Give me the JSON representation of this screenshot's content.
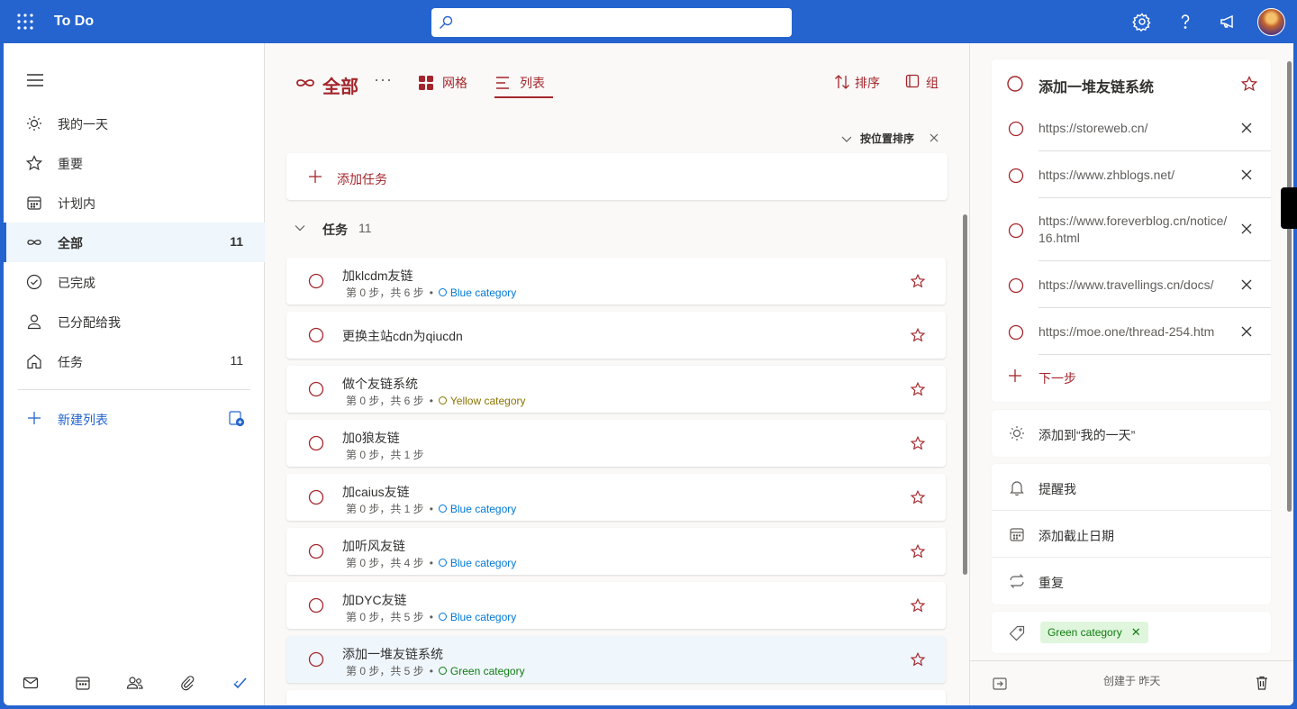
{
  "app": {
    "title": "To Do"
  },
  "search": {
    "value": "",
    "placeholder": ""
  },
  "colors": {
    "brand": "#2564cf",
    "accent": "#a4262c",
    "blue_category": "#0078d4",
    "yellow_category": "#8a7400",
    "green_category": "#107c10"
  },
  "sidebar": {
    "items": [
      {
        "label": "我的一天",
        "count": "",
        "icon": "sun-icon"
      },
      {
        "label": "重要",
        "count": "",
        "icon": "star-icon"
      },
      {
        "label": "计划内",
        "count": "",
        "icon": "calendar-icon"
      },
      {
        "label": "全部",
        "count": "11",
        "icon": "infinity-icon"
      },
      {
        "label": "已完成",
        "count": "",
        "icon": "check-circle-icon"
      },
      {
        "label": "已分配给我",
        "count": "",
        "icon": "person-icon"
      },
      {
        "label": "任务",
        "count": "11",
        "icon": "home-icon"
      }
    ],
    "new_list_label": "新建列表"
  },
  "list": {
    "title": "全部",
    "more": "···",
    "view_grid": "网格",
    "view_list": "列表",
    "sort_label": "排序",
    "group_label": "组",
    "sort_chip": "按位置排序",
    "add_task": "添加任务",
    "group_title": "任务",
    "group_count": "11",
    "tasks": [
      {
        "title": "加klcdm友链",
        "steps": "第 0 步，共 6 步",
        "category": "Blue category",
        "cat_color": "#0078d4"
      },
      {
        "title": "更换主站cdn为qiucdn",
        "steps": "",
        "category": "",
        "cat_color": ""
      },
      {
        "title": "做个友链系统",
        "steps": "第 0 步，共 6 步",
        "category": "Yellow category",
        "cat_color": "#8a7400"
      },
      {
        "title": "加0狼友链",
        "steps": "第 0 步，共 1 步",
        "category": "",
        "cat_color": ""
      },
      {
        "title": "加caius友链",
        "steps": "第 0 步，共 1 步",
        "category": "Blue category",
        "cat_color": "#0078d4"
      },
      {
        "title": "加听风友链",
        "steps": "第 0 步，共 4 步",
        "category": "Blue category",
        "cat_color": "#0078d4"
      },
      {
        "title": "加DYC友链",
        "steps": "第 0 步，共 5 步",
        "category": "Blue category",
        "cat_color": "#0078d4"
      },
      {
        "title": "添加一堆友链系统",
        "steps": "第 0 步，共 5 步",
        "category": "Green category",
        "cat_color": "#107c10"
      }
    ]
  },
  "detail": {
    "title": "添加一堆友链系统",
    "steps": [
      "https://storeweb.cn/",
      "https://www.zhblogs.net/",
      "https://www.foreverblog.cn/notice/16.html",
      "https://www.travellings.cn/docs/",
      "https://moe.one/thread-254.htm"
    ],
    "next_step": "下一步",
    "add_my_day": "添加到“我的一天”",
    "remind": "提醒我",
    "due_date": "添加截止日期",
    "repeat": "重复",
    "tag": "Green category",
    "created": "创建于 昨天"
  }
}
